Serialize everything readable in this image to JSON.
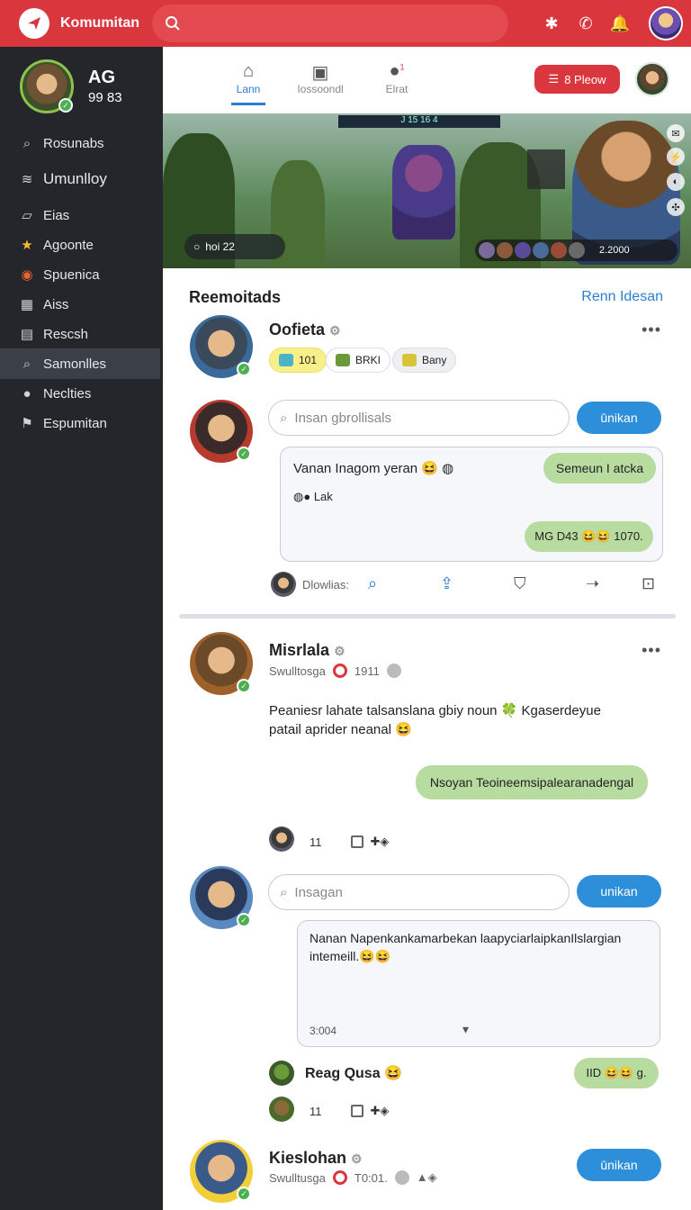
{
  "topbar": {
    "app_title": "Komumitan"
  },
  "sidebar": {
    "profile": {
      "name": "AG",
      "sub": "99 83"
    },
    "items": [
      {
        "label": "Rosunabs",
        "icon": "search-icon"
      },
      {
        "label": "Umunlloy",
        "icon": "waves-icon"
      },
      {
        "label": "Eias",
        "icon": "book-icon"
      },
      {
        "label": "Agoonte",
        "icon": "star-icon"
      },
      {
        "label": "Spuenica",
        "icon": "wifi-icon"
      },
      {
        "label": "Aiss",
        "icon": "grid-icon"
      },
      {
        "label": "Rescsh",
        "icon": "calendar-icon"
      },
      {
        "label": "Samonlles",
        "icon": "search-icon",
        "active": true
      },
      {
        "label": "Neclties",
        "icon": "circle-icon"
      },
      {
        "label": "Espumitan",
        "icon": "flag-icon"
      }
    ]
  },
  "tabs": [
    {
      "label": "Lann",
      "icon": "home-icon",
      "active": true
    },
    {
      "label": "Iossoondl",
      "icon": "gallery-icon"
    },
    {
      "label": "Elrat",
      "icon": "chat-icon",
      "badge": "1"
    }
  ],
  "plan_button": "8 Pleow",
  "banner": {
    "hud": "J  15  16  4",
    "timer": "hoi 22",
    "score": "2.2000"
  },
  "section": {
    "title": "Reemoitads",
    "link": "Renn Idesan"
  },
  "post1": {
    "name": "Oofieta",
    "chips": [
      "101",
      "BRKI",
      "Bany"
    ],
    "comment_placeholder": "Insan gbrollisals",
    "button": "ūnikan",
    "message": "Vanan Inagom yeran 😆",
    "reply_bubble": "Semeun I atcka",
    "sub_line": "Lak",
    "green_bubble": "MG D43 😆😆 1070.",
    "action_label": "Dlowlias:"
  },
  "post2": {
    "name": "Misrlala",
    "handle": "Swulltosga",
    "count": "1911",
    "body_line1": "Peaniesr lahate talsanslana gbiy noun 🍀 Kgaserdeyue",
    "body_line2": "patail aprider neanal 😆",
    "green_bubble": "Nsoyan Teoineemsipalearanadengal",
    "likes": "11"
  },
  "post3": {
    "comment_placeholder": "Insagan",
    "button": "unikan",
    "message_line1": "Nanan Napenkankamarbekan laapyciarlaipkanIlslargian",
    "message_line2": "intemeill.😆😆",
    "time": "3:004",
    "reply_name": "Reag Qusa 😆",
    "reply_bubble": "IID 😆😆 g.",
    "likes": "11"
  },
  "post4": {
    "name": "Kieslohan",
    "handle": "Swulltusga",
    "count": "T0:01.",
    "button": "ūnikan"
  }
}
